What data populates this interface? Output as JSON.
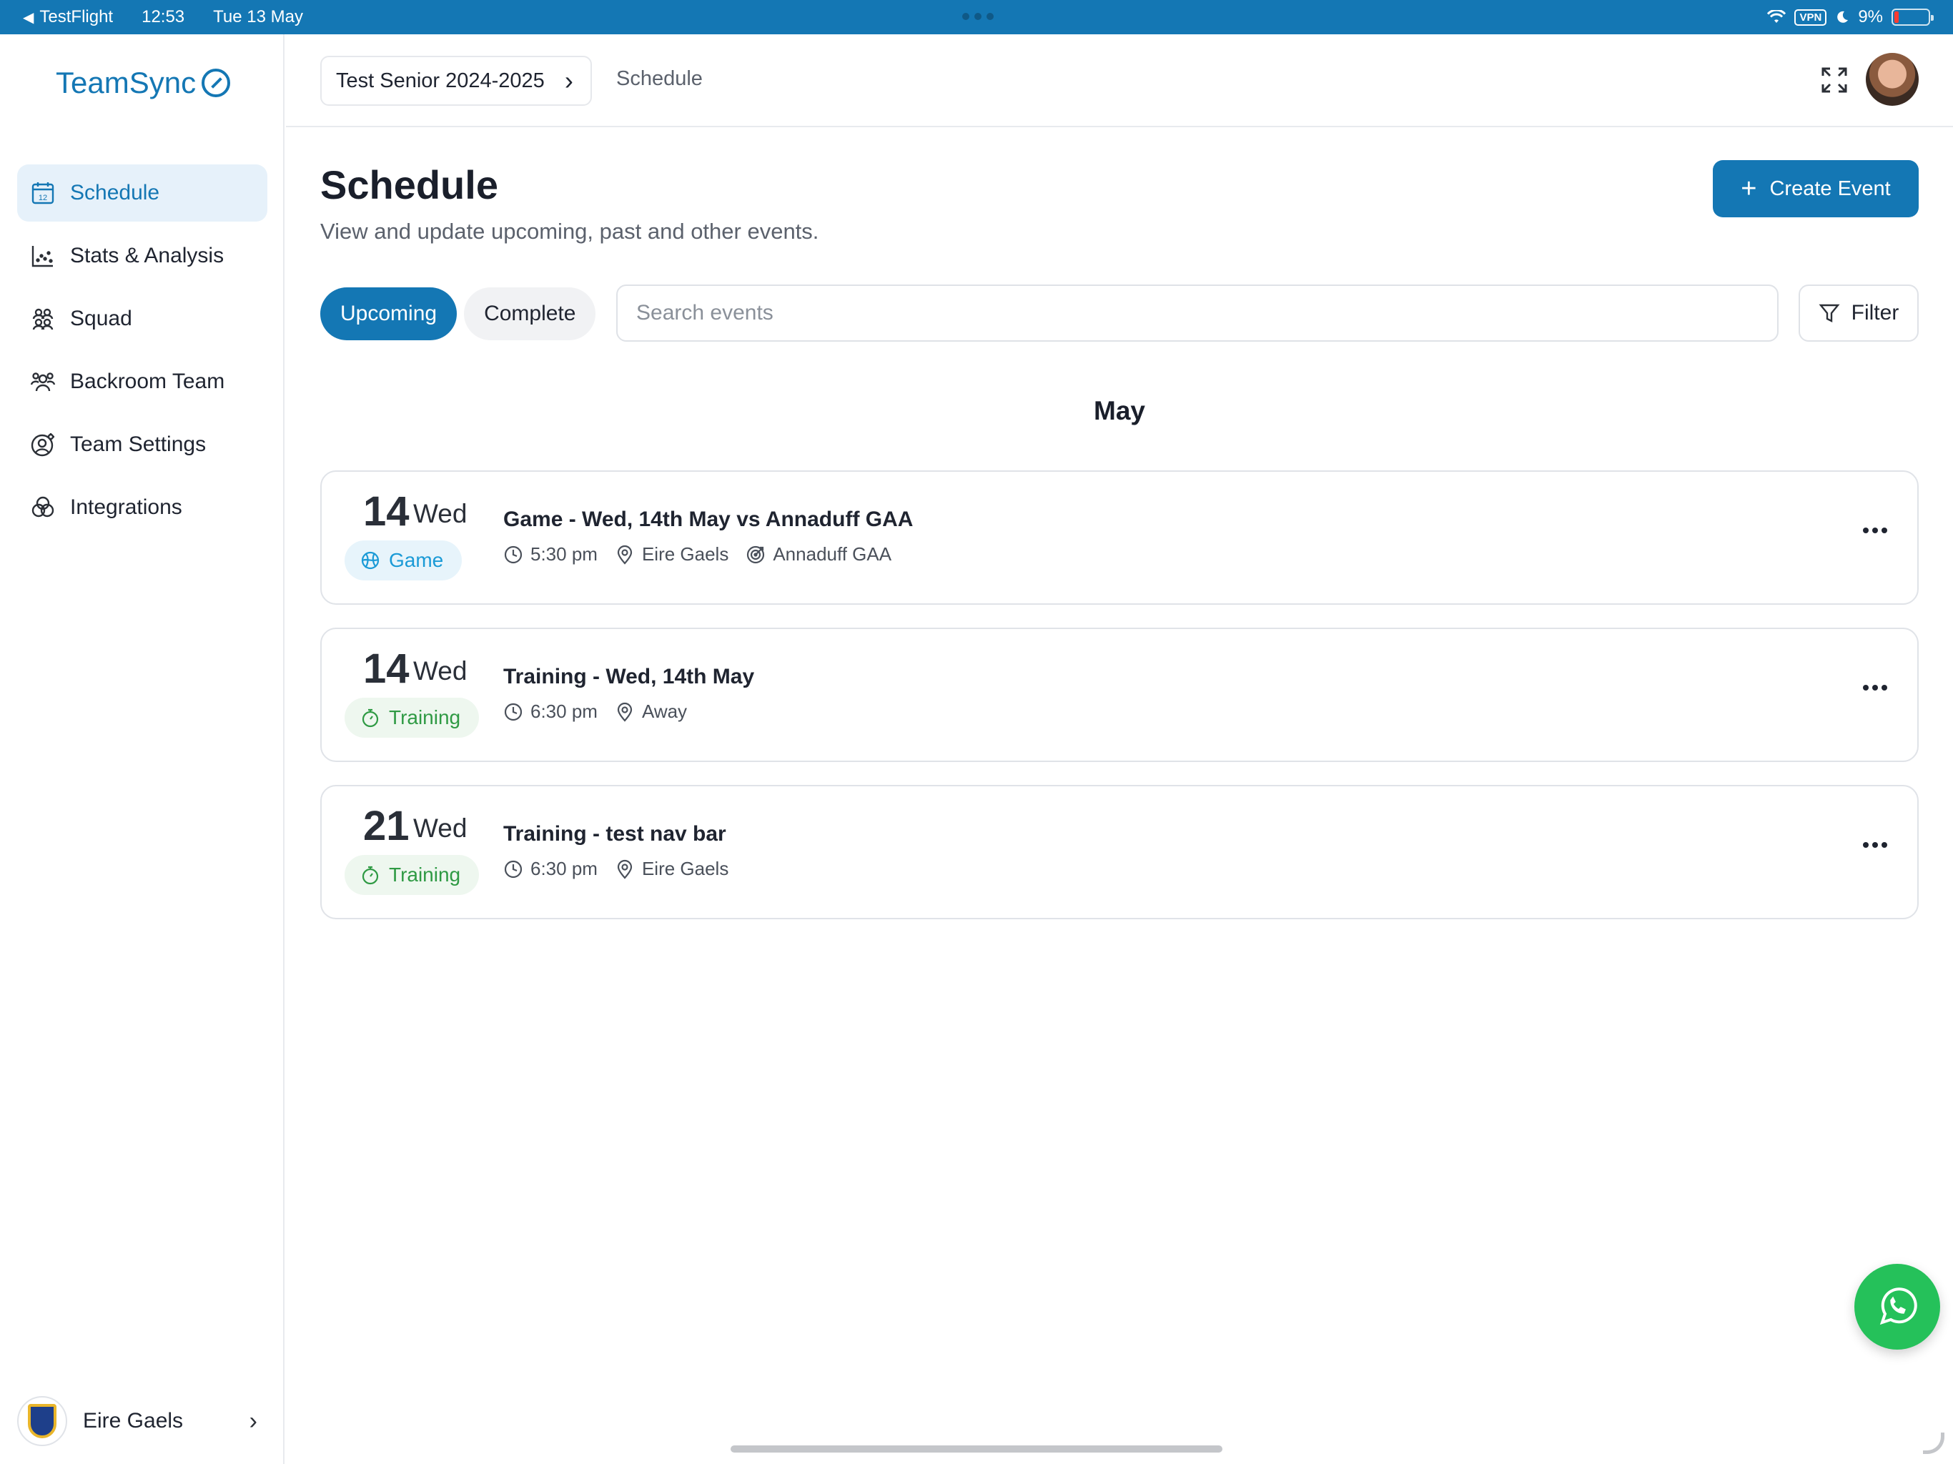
{
  "status_bar": {
    "back_app": "TestFlight",
    "time": "12:53",
    "date": "Tue 13 May",
    "vpn": "VPN",
    "battery": "9%"
  },
  "sidebar": {
    "logo": "TeamSync",
    "items": [
      {
        "label": "Schedule",
        "icon": "calendar-icon",
        "active": true
      },
      {
        "label": "Stats & Analysis",
        "icon": "chart-icon"
      },
      {
        "label": "Squad",
        "icon": "squad-icon"
      },
      {
        "label": "Backroom Team",
        "icon": "people-icon"
      },
      {
        "label": "Team Settings",
        "icon": "user-gear-icon"
      },
      {
        "label": "Integrations",
        "icon": "circles-icon"
      }
    ],
    "team": {
      "name": "Eire Gaels"
    }
  },
  "header": {
    "breadcrumb_team": "Test Senior 2024-2025",
    "breadcrumb_page": "Schedule"
  },
  "page": {
    "title": "Schedule",
    "subtitle": "View and update upcoming, past and other events.",
    "create_label": "Create Event",
    "tabs": [
      {
        "label": "Upcoming",
        "active": true
      },
      {
        "label": "Complete",
        "active": false
      }
    ],
    "search_placeholder": "Search events",
    "filter_label": "Filter",
    "month": "May"
  },
  "events": [
    {
      "day": "14",
      "weekday": "Wed",
      "type": "Game",
      "title": "Game - Wed, 14th May vs Annaduff GAA",
      "time": "5:30 pm",
      "location": "Eire Gaels",
      "opponent": "Annaduff GAA"
    },
    {
      "day": "14",
      "weekday": "Wed",
      "type": "Training",
      "title": "Training - Wed, 14th May",
      "time": "6:30 pm",
      "location": "Away"
    },
    {
      "day": "21",
      "weekday": "Wed",
      "type": "Training",
      "title": "Training - test nav bar",
      "time": "6:30 pm",
      "location": "Eire Gaels"
    }
  ],
  "colors": {
    "accent": "#1477b4",
    "game": "#1a9ad6",
    "training": "#2f9a44",
    "whatsapp": "#25c15a"
  }
}
